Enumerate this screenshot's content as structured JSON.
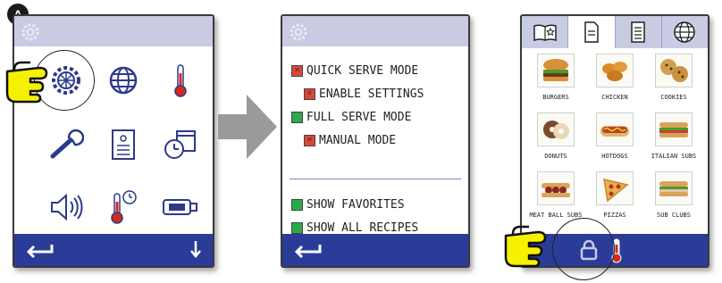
{
  "badge": "A",
  "screen1": {
    "icons": [
      "gear-icon",
      "globe-icon",
      "thermometer-icon",
      "wrench-icon",
      "manual-icon",
      "clock-calendar-icon",
      "speaker-icon",
      "thermometer-clock-icon",
      "usb-icon"
    ]
  },
  "screen2": {
    "items": [
      {
        "label": "QUICK SERVE MODE",
        "state": "red"
      },
      {
        "label": "ENABLE SETTINGS",
        "state": "red"
      },
      {
        "label": "FULL SERVE MODE",
        "state": "green"
      },
      {
        "label": "MANUAL MODE",
        "state": "red"
      },
      {
        "label": "SHOW FAVORITES",
        "state": "green"
      },
      {
        "label": "SHOW ALL RECIPES",
        "state": "green"
      }
    ]
  },
  "screen3": {
    "tabs": [
      "book-star-icon",
      "document-icon",
      "list-icon",
      "globe-icon"
    ],
    "recipes": [
      "BURGERS",
      "CHICKEN",
      "COOKIES",
      "DONUTS",
      "HOTDOGS",
      "ITALIAN SUBS",
      "MEAT BALL SUBS",
      "PIZZAS",
      "SUB CLUBS"
    ]
  },
  "colors": {
    "bar_top": "#c9cbe3",
    "bar_bottom": "#2b3b98",
    "hand": "#f6f100",
    "check_red": "#d8483a",
    "check_green": "#2aaa4a"
  }
}
